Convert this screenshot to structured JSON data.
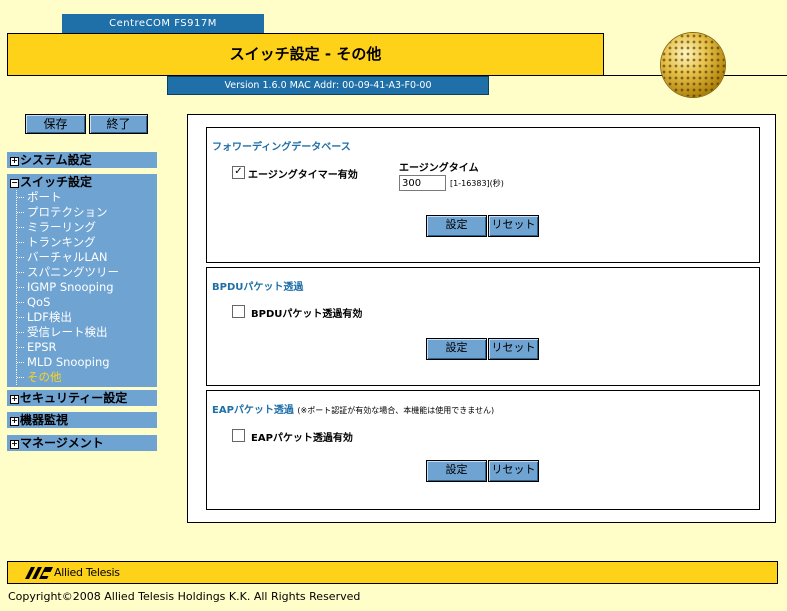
{
  "header": {
    "model": "CentreCOM FS917M",
    "title": "スイッチ設定 - その他",
    "version": "Version 1.6.0 MAC Addr: 00-09-41-A3-F0-00"
  },
  "top_buttons": {
    "save": "保存",
    "exit": "終了"
  },
  "sidebar": {
    "system": "システム設定",
    "switch": "スイッチ設定",
    "switch_items": [
      "ポート",
      "プロテクション",
      "ミラーリング",
      "トランキング",
      "バーチャルLAN",
      "スパニングツリー",
      "IGMP Snooping",
      "QoS",
      "LDF検出",
      "受信レート検出",
      "EPSR",
      "MLD Snooping",
      "その他"
    ],
    "security": "セキュリティー設定",
    "monitor": "機器監視",
    "management": "マネージメント",
    "collapsed_marker": "+",
    "expanded_marker": "−"
  },
  "fdb": {
    "title": "フォワーディングデータベース",
    "aging_enable_label": "エージングタイマー有効",
    "aging_enable_checked": true,
    "aging_time_label": "エージングタイム",
    "aging_time_value": "300",
    "aging_time_range": "[1-16383](秒)",
    "set": "設定",
    "reset": "リセット"
  },
  "bpdu": {
    "title": "BPDUパケット透過",
    "enable_label": "BPDUパケット透過有効",
    "enable_checked": false,
    "set": "設定",
    "reset": "リセット"
  },
  "eap": {
    "title": "EAPパケット透過",
    "note": "(※ポート認証が有効な場合、本機能は使用できません)",
    "enable_label": "EAPパケット透過有効",
    "enable_checked": false,
    "set": "設定",
    "reset": "リセット"
  },
  "footer": {
    "logo_text": "Allied Telesis",
    "copyright": "Copyright©2008 Allied Telesis Holdings K.K. All Rights Reserved"
  },
  "colors": {
    "yellow": "#ffd21a",
    "blue": "#1f6fa8",
    "nav_blue": "#6fa3d2",
    "page_bg": "#fffdc8"
  }
}
